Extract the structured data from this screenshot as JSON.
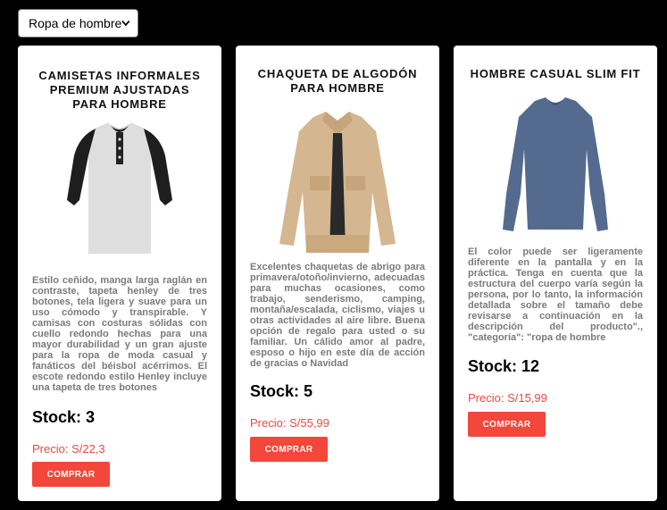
{
  "filter": {
    "selected": "Ropa de hombre"
  },
  "products": [
    {
      "title": "CAMISETAS INFORMALES PREMIUM AJUSTADAS PARA HOMBRE",
      "description": "Estilo ceñido, manga larga raglán en contraste, tapeta henley de tres botones, tela ligera y suave para un uso cómodo y transpirable. Y camisas con costuras sólidas con cuello redondo hechas para una mayor durabilidad y un gran ajuste para la ropa de moda casual y fanáticos del béisbol acérrimos. El escote redondo estilo Henley incluye una tapeta de tres botones",
      "stock": "Stock: 3",
      "price": "Precio: S/22,3",
      "button": "COMPRAR"
    },
    {
      "title": "CHAQUETA DE ALGODÓN PARA HOMBRE",
      "description": "Excelentes chaquetas de abrigo para primavera/otoño/invierno, adecuadas para muchas ocasiones, como trabajo, senderismo, camping, montaña/escalada, ciclismo, viajes u otras actividades al aire libre. Buena opción de regalo para usted o su familiar. Un cálido amor al padre, esposo o hijo en este día de acción de gracias o Navidad",
      "stock": "Stock: 5",
      "price": "Precio: S/55,99",
      "button": "COMPRAR"
    },
    {
      "title": "HOMBRE CASUAL SLIM FIT",
      "description": "El color puede ser ligeramente diferente en la pantalla y en la práctica. Tenga en cuenta que la estructura del cuerpo varía según la persona, por lo tanto, la información detallada sobre el tamaño debe revisarse a continuación en la descripción del producto\"., \"categoría\": \"ropa de hombre",
      "stock": "Stock: 12",
      "price": "Precio: S/15,99",
      "button": "COMPRAR"
    }
  ]
}
